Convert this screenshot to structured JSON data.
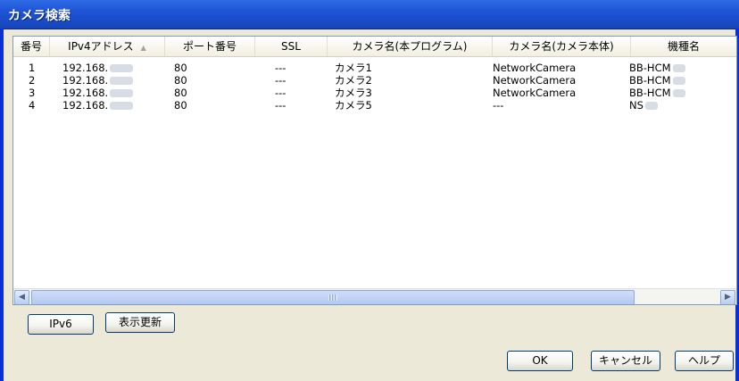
{
  "window": {
    "title": "カメラ検索"
  },
  "columns": [
    "番号",
    "IPv4アドレス",
    "ポート番号",
    "SSL",
    "カメラ名(本プログラム)",
    "カメラ名(カメラ本体)",
    "機種名"
  ],
  "sort_indicator": "▲",
  "rows": [
    {
      "num": "1",
      "ip": "192.168.",
      "port": "80",
      "ssl": "---",
      "name_prog": "カメラ1",
      "name_cam": "NetworkCamera",
      "model": "BB-HCM"
    },
    {
      "num": "2",
      "ip": "192.168.",
      "port": "80",
      "ssl": "---",
      "name_prog": "カメラ2",
      "name_cam": "NetworkCamera",
      "model": "BB-HCM"
    },
    {
      "num": "3",
      "ip": "192.168.",
      "port": "80",
      "ssl": "---",
      "name_prog": "カメラ3",
      "name_cam": "NetworkCamera",
      "model": "BB-HCM"
    },
    {
      "num": "4",
      "ip": "192.168.",
      "port": "80",
      "ssl": "---",
      "name_prog": "カメラ5",
      "name_cam": "---",
      "model": "NS"
    }
  ],
  "scrollbar": {
    "left_arrow": "◀",
    "right_arrow": "▶"
  },
  "buttons": {
    "ipv6": "IPv6",
    "refresh": "表示更新",
    "ok": "OK",
    "cancel": "キャンセル",
    "help": "ヘルプ"
  }
}
